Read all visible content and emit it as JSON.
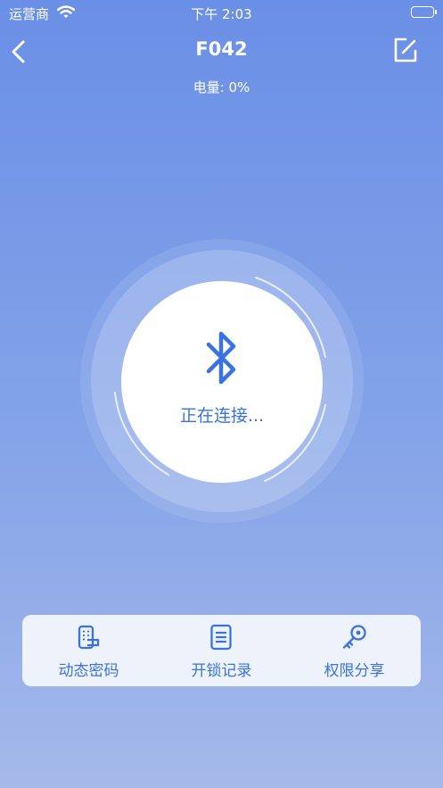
{
  "status_bar": {
    "carrier": "运营商",
    "time": "下午 2:03"
  },
  "nav": {
    "title": "F042",
    "back_icon": "chevron-left-icon",
    "edit_icon": "edit-icon"
  },
  "battery_level": "电量: 0%",
  "connection": {
    "status": "正在连接...",
    "icon": "bluetooth-icon"
  },
  "actions": [
    {
      "label": "动态密码",
      "icon": "keypad-lock-icon"
    },
    {
      "label": "开锁记录",
      "icon": "document-icon"
    },
    {
      "label": "权限分享",
      "icon": "key-icon"
    }
  ],
  "colors": {
    "accent": "#3a73e0",
    "bg_top": "#6a8fe6",
    "bg_bottom": "#a5b9ea",
    "panel": "#eef3fb"
  }
}
